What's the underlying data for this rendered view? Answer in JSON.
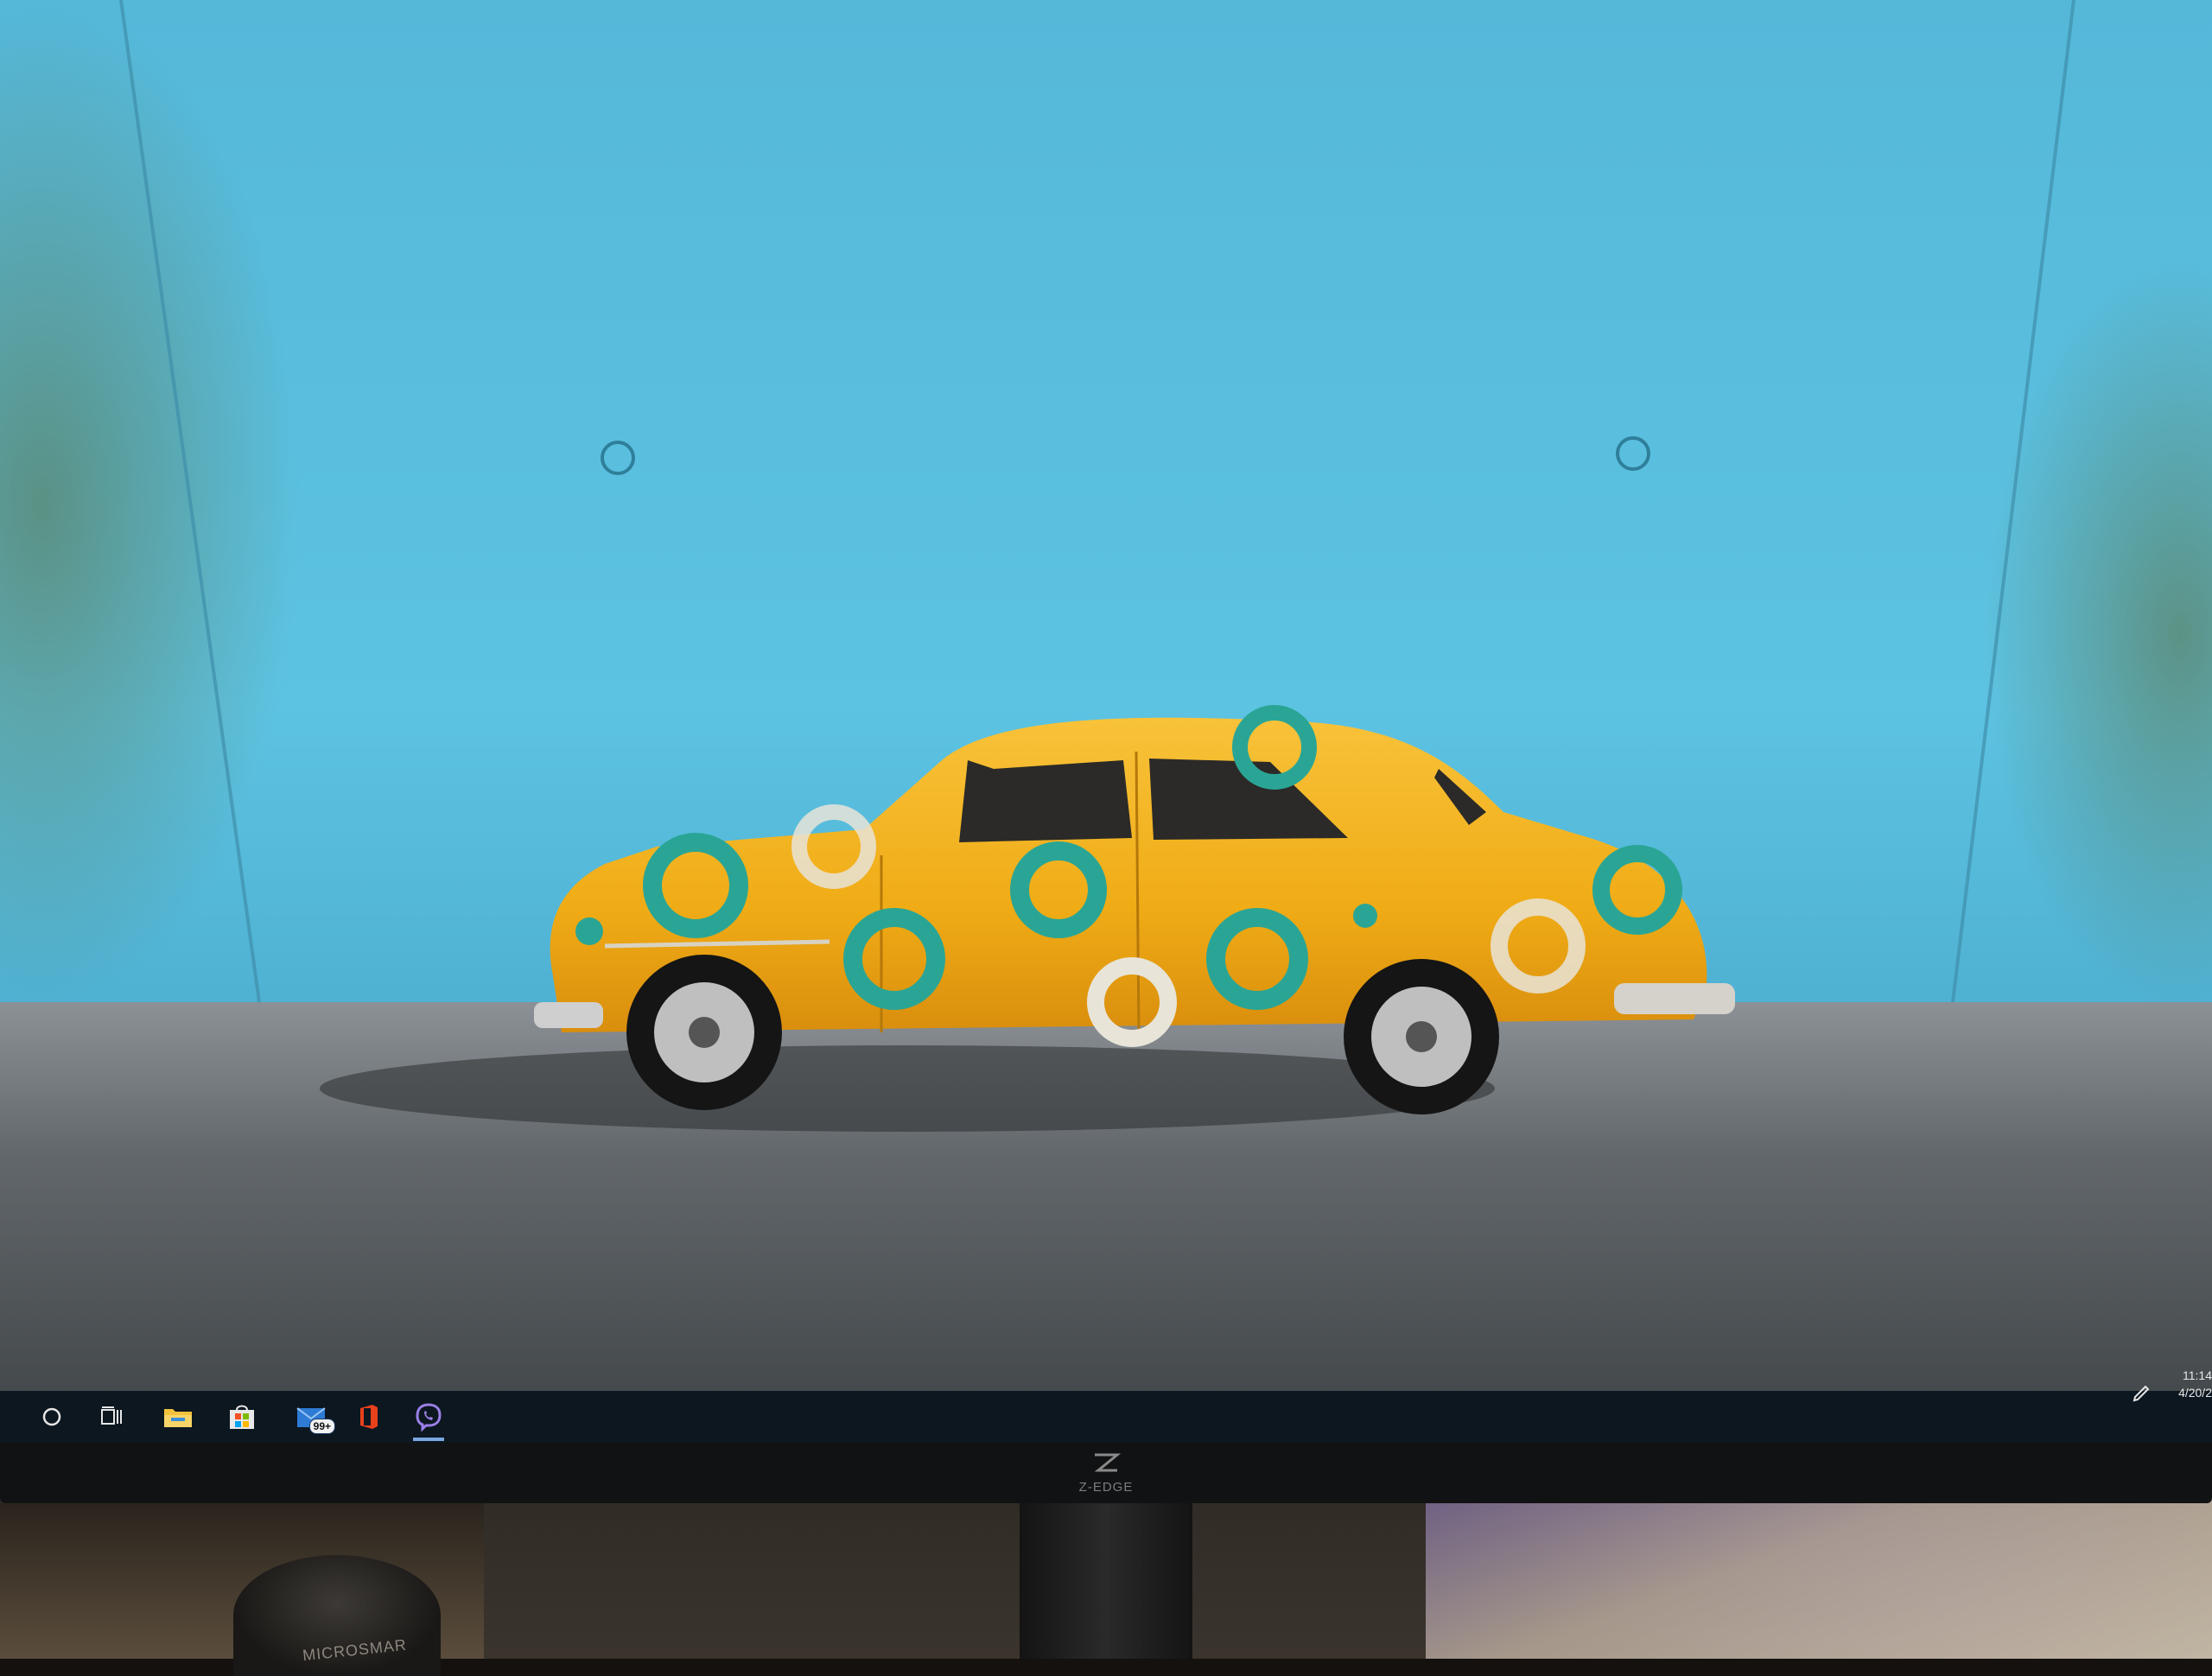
{
  "screen": {
    "wallpaper": {
      "colors": {
        "wall": "#5cc0de",
        "floor": "#5f6366",
        "car_body": "#f4b41f",
        "car_circles": "#2aa595"
      }
    }
  },
  "taskbar": {
    "items": [
      {
        "icon": "search-circle-icon"
      },
      {
        "icon": "task-view-icon"
      },
      {
        "icon": "file-explorer-icon"
      },
      {
        "icon": "microsoft-store-icon"
      },
      {
        "icon": "mail-icon",
        "badge": "99+"
      },
      {
        "icon": "office-icon"
      },
      {
        "icon": "viber-icon",
        "active": true
      }
    ],
    "tray": {
      "pen_icon": "pen-icon",
      "time": "11:14",
      "date": "4/20/2"
    },
    "colors": {
      "background": "#0c1720",
      "active_indicator": "#7aa7e0"
    }
  },
  "monitor": {
    "brand": "Z-EDGE"
  },
  "desk": {
    "mouse_label": "MICROSMAR"
  }
}
